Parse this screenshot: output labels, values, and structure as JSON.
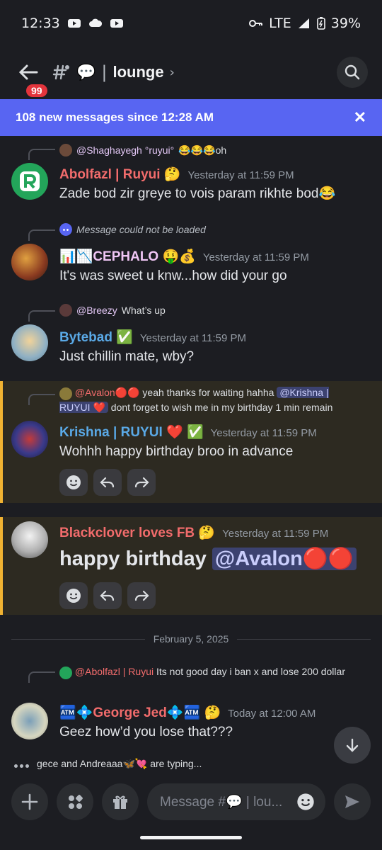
{
  "status": {
    "time": "12:33",
    "network": "LTE",
    "battery": "39%"
  },
  "header": {
    "badge": "99",
    "channel": "lounge"
  },
  "banner": {
    "text": "108 new messages since 12:28 AM"
  },
  "messages": [
    {
      "reply_name": "@Shaghayegh °ruyui°",
      "reply_text": "😂😂😂oh",
      "author": "Abolfazl | Ruyui 🤔",
      "author_color": "#f26c6c",
      "time": "Yesterday at 11:59 PM",
      "text": "Zade bod zir greye to vois param rikhte bod😂"
    },
    {
      "reply_name": "",
      "reply_text": "Message could not be loaded",
      "author": "📊📉CEPHALO 🤑💰",
      "author_color": "#f0c6f5",
      "time": "Yesterday at 11:59 PM",
      "text": "It's was sweet u knw...how did your go"
    },
    {
      "reply_name": "@Breezy",
      "reply_text": "What’s up",
      "author": "Bytebad ✅",
      "author_color": "#5aa9e6",
      "time": "Yesterday at 11:59 PM",
      "text": "Just chillin mate, wby?"
    },
    {
      "reply_name": "@Avalon🔴🔴",
      "reply_text": "yeah thanks for waiting hahha",
      "reply_mention": "@Krishna | RUYUI ❤️",
      "reply_text2": "dont forget to wish me in my birthday 1 min remain",
      "author": "Krishna | RUYUI ❤️ ✅",
      "author_color": "#5aa9e6",
      "time": "Yesterday at 11:59 PM",
      "text": "Wohhh happy birthday broo in advance"
    },
    {
      "author": "Blackclover loves FB 🤔",
      "author_color": "#f26c6c",
      "time": "Yesterday at 11:59 PM",
      "text": "happy birthday",
      "mention": "@Avalon🔴🔴"
    },
    {
      "reply_name": "@Abolfazl | Ruyui",
      "reply_text": "Its not good day i ban x and lose 200 dollar",
      "author": "🏧💠George Jed💠🏧 🤔",
      "author_color": "#f26c6c",
      "time": "Today at 12:00 AM",
      "text": "Geez how’d you lose that???"
    }
  ],
  "date_divider": "February 5, 2025",
  "typing": "gece and Andreaaa🦋💘 are typing...",
  "composer": {
    "placeholder": "Message #💬 | lou..."
  },
  "colors": {
    "accent": "#5865f2",
    "highlight_bar": "#f0b232"
  }
}
